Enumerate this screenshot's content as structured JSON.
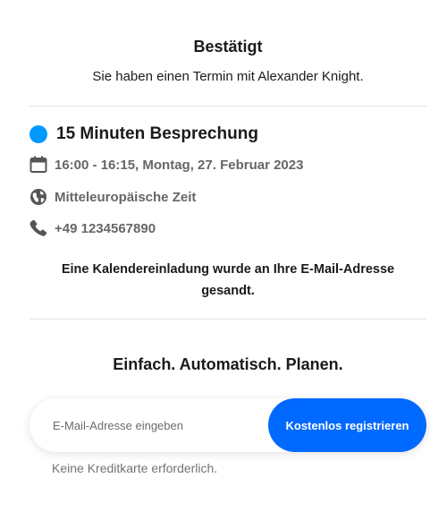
{
  "header": {
    "title": "Bestätigt",
    "subtitle": "Sie haben einen Termin mit Alexander Knight."
  },
  "event": {
    "title": "15 Minuten Besprechung",
    "dot_color": "#0099ff",
    "details": [
      {
        "icon": "calendar-icon",
        "text": "16:00 - 16:15, Montag, 27. Februar 2023"
      },
      {
        "icon": "globe-icon",
        "text": "Mitteleuropäische Zeit"
      },
      {
        "icon": "phone-icon",
        "text": "+49 1234567890"
      }
    ]
  },
  "invite_message": "Eine Kalendereinladung wurde an Ihre E-Mail-Adresse gesandt.",
  "promo": {
    "heading": "Einfach. Automatisch. Planen.",
    "email_placeholder": "E-Mail-Adresse eingeben",
    "email_value": "",
    "button_label": "Kostenlos registrieren",
    "button_color": "#0069ff",
    "note": "Keine Kreditkarte erforderlich."
  }
}
